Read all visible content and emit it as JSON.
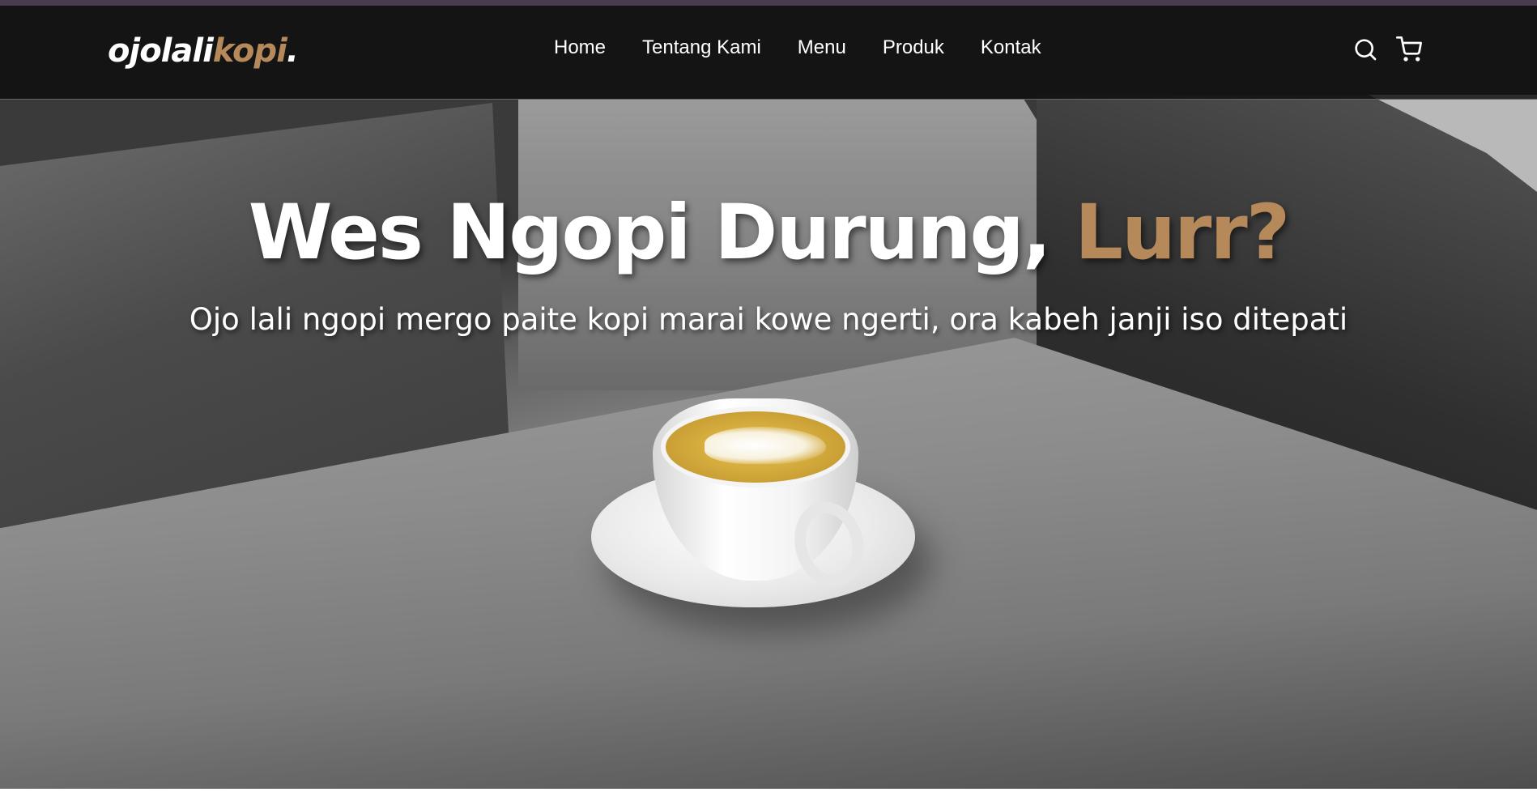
{
  "brand": {
    "name_main": "ojolali",
    "name_accent": "kopi",
    "name_suffix": ".",
    "accent_color": "#b6895b"
  },
  "nav": {
    "items": [
      {
        "label": "Home"
      },
      {
        "label": "Tentang Kami"
      },
      {
        "label": "Menu"
      },
      {
        "label": "Produk"
      },
      {
        "label": "Kontak"
      }
    ],
    "icons": [
      "search-icon",
      "shopping-cart-icon"
    ]
  },
  "hero": {
    "title_main": "Wes Ngopi Durung, ",
    "title_accent": "Lurr?",
    "subtitle": "Ojo lali ngopi mergo paite kopi marai kowe ngerti, ora kabeh janji iso ditepati"
  },
  "colors": {
    "topline": "#4a3b4f",
    "navbar_bg": "#0c0c0c",
    "text": "#ffffff"
  }
}
